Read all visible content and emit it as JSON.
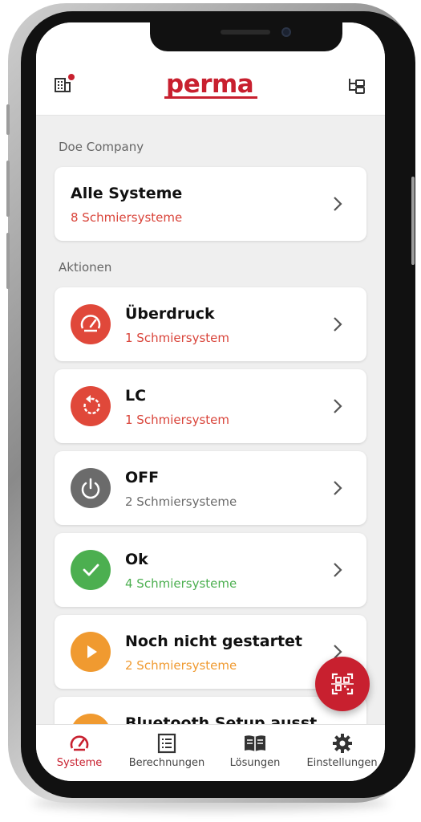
{
  "header": {
    "logo_text": "perma",
    "left_icon": "building-icon",
    "right_icon": "hierarchy-icon"
  },
  "company_label": "Doe Company",
  "all_systems": {
    "title": "Alle Systeme",
    "count": "8 Schmiersysteme"
  },
  "actions_label": "Aktionen",
  "actions": [
    {
      "title": "Überdruck",
      "count": "1 Schmiersystem",
      "icon": "gauge-icon",
      "color": "#e0483a"
    },
    {
      "title": "LC",
      "count": "1 Schmiersystem",
      "icon": "refresh-icon",
      "color": "#e0483a"
    },
    {
      "title": "OFF",
      "count": "2 Schmiersysteme",
      "icon": "power-icon",
      "color": "#6b6b6b"
    },
    {
      "title": "Ok",
      "count": "4 Schmiersysteme",
      "icon": "check-icon",
      "color": "#4caf50"
    },
    {
      "title": "Noch nicht gestartet",
      "count": "2 Schmiersysteme",
      "icon": "play-icon",
      "color": "#f09a30"
    },
    {
      "title": "Bluetooth Setup ausst",
      "count": "",
      "icon": "bluetooth-icon",
      "color": "#f09a30"
    }
  ],
  "colors": {
    "brand": "#c8202f",
    "red_text": "#d9443a",
    "gray_text": "#6b6b6b",
    "green_text": "#4caf50",
    "orange_text": "#f09a30"
  },
  "fab": {
    "icon": "qr-scan-icon"
  },
  "bottom_nav": [
    {
      "label": "Systeme",
      "icon": "gauge-icon",
      "active": true
    },
    {
      "label": "Berechnungen",
      "icon": "list-icon",
      "active": false
    },
    {
      "label": "Lösungen",
      "icon": "book-icon",
      "active": false
    },
    {
      "label": "Einstellungen",
      "icon": "gear-icon",
      "active": false
    }
  ]
}
